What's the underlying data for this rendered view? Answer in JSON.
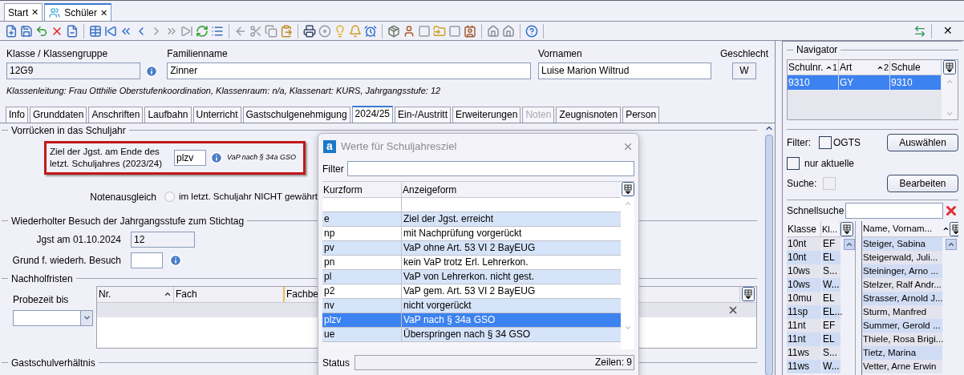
{
  "tabs": [
    {
      "label": "Start",
      "selected": false,
      "close": "✕"
    },
    {
      "label": "Schüler",
      "selected": true,
      "close": "✕"
    }
  ],
  "toolbar": {
    "close": "✕"
  },
  "header": {
    "klasse": {
      "label": "Klasse / Klassengruppe",
      "value": "12G9"
    },
    "familienname": {
      "label": "Familienname",
      "value": "Zinner"
    },
    "vornamen": {
      "label": "Vornamen",
      "value": "Luise Marion Wiltrud"
    },
    "geschlecht": {
      "label": "Geschlecht",
      "value": "W"
    },
    "klassenleitung": "Klassenleitung: Frau Otthilie Oberstufenkoordination, Klassenraum: n/a, Klassenart: KURS, Jahrgangsstufe: 12"
  },
  "subtabs": [
    {
      "label": "Info",
      "selected": false,
      "disabled": false
    },
    {
      "label": "Grunddaten",
      "selected": false,
      "disabled": false
    },
    {
      "label": "Anschriften",
      "selected": false,
      "disabled": false
    },
    {
      "label": "Laufbahn",
      "selected": false,
      "disabled": false
    },
    {
      "label": "Unterricht",
      "selected": false,
      "disabled": false
    },
    {
      "label": "Gastschulgenehmigung",
      "selected": false,
      "disabled": false
    },
    {
      "label": "2024/25",
      "selected": true,
      "disabled": false
    },
    {
      "label": "Ein-/Austritt",
      "selected": false,
      "disabled": false
    },
    {
      "label": "Erweiterungen",
      "selected": false,
      "disabled": false
    },
    {
      "label": "Noten",
      "selected": false,
      "disabled": true
    },
    {
      "label": "Zeugnisnoten",
      "selected": false,
      "disabled": false
    },
    {
      "label": "Person",
      "selected": false,
      "disabled": false
    }
  ],
  "vorruecken": {
    "title": "Vorrücken in das Schuljahr",
    "ziel_label": "Ziel der Jgst. am Ende des letzt. Schuljahres (2023/24)",
    "ziel_value": "plzv",
    "ziel_hint": "VaP nach § 34a GSO",
    "notenausgleich_label": "Notenausgleich",
    "notenausgleich_option": {
      "label": "im letzt. Schuljahr NICHT gewährt",
      "checked": false
    }
  },
  "wiederholung": {
    "title": "Wiederholter Besuch der Jahrgangsstufe zum Stichtag",
    "jgst_label": "Jgst am 01.10.2024",
    "jgst_value": "12",
    "grund_label": "Grund f. wiederh. Besuch"
  },
  "nachholfristen": {
    "title": "Nachholfristen",
    "probezeit_label": "Probezeit bis",
    "columns": [
      "Nr.",
      "Fach",
      "Fachbe"
    ]
  },
  "gastschul": {
    "title": "Gastschulverhältnis"
  },
  "dialog": {
    "logo": "a",
    "title": "Werte für Schuljahresziel",
    "filter_label": "Filter",
    "columns": [
      "Kurzform",
      "Anzeigeform"
    ],
    "rows": [
      {
        "kurz": "e",
        "anzeige": "Ziel der Jgst. erreicht",
        "selected": false
      },
      {
        "kurz": "np",
        "anzeige": "mit Nachprüfung vorgerückt",
        "selected": false
      },
      {
        "kurz": "pv",
        "anzeige": "VaP ohne Art. 53 VI 2 BayEUG",
        "selected": false
      },
      {
        "kurz": "pn",
        "anzeige": "kein VaP trotz Erl. Lehrerkon.",
        "selected": false
      },
      {
        "kurz": "pl",
        "anzeige": "VaP von Lehrerkon. nicht gest.",
        "selected": false
      },
      {
        "kurz": "p2",
        "anzeige": "VaP gem. Art. 53 VI 2 BayEUG",
        "selected": false
      },
      {
        "kurz": "nv",
        "anzeige": "nicht vorgerückt",
        "selected": false
      },
      {
        "kurz": "plzv",
        "anzeige": "VaP nach § 34a GSO",
        "selected": true
      },
      {
        "kurz": "ue",
        "anzeige": "Überspringen nach § 34 GSO",
        "selected": false
      }
    ],
    "status_label": "Status",
    "status_value": "Zeilen: 9"
  },
  "navigator": {
    "title": "Navigator",
    "columns": [
      {
        "label": "Schulnr.",
        "sort": "1"
      },
      {
        "label": "Art",
        "sort": "2"
      },
      {
        "label": "Schule"
      }
    ],
    "rows": [
      {
        "cells": [
          "9310",
          "GY",
          "9310"
        ],
        "selected": true
      }
    ],
    "filter_label": "Filter:",
    "ogts": {
      "label": "OGTS",
      "checked": false
    },
    "select_button": "Auswählen",
    "nur_aktuelle": {
      "label": "nur aktuelle",
      "checked": false
    },
    "suche": {
      "label": "Suche:",
      "checked": false,
      "disabled": true
    },
    "edit_button": "Bearbeiten",
    "schnellsuche_label": "Schnellsuche",
    "class_columns": [
      "Klasse",
      "Kl..."
    ],
    "class_rows": [
      [
        "10nt",
        "EF"
      ],
      [
        "10nt",
        "EL"
      ],
      [
        "10ws",
        "S..."
      ],
      [
        "10ws",
        "W..."
      ],
      [
        "10mu",
        "EL"
      ],
      [
        "11sp",
        "EL..."
      ],
      [
        "11nt",
        "EF"
      ],
      [
        "11nt",
        "EL"
      ],
      [
        "11ws",
        "S..."
      ],
      [
        "11ws",
        "W..."
      ]
    ],
    "name_column": "Name, Vornam...",
    "names": [
      "Steiger, Sabina",
      "Steigerwald, Juli...",
      "Steininger, Arno ...",
      "Stelzer, Ralf Andr...",
      "Strasser, Arnold J...",
      "Sturm, Manfred",
      "Summer, Gerold ...",
      "Thiele, Rosa Brigi...",
      "Tietz, Marina",
      "Vetter, Arne Erwin"
    ]
  }
}
